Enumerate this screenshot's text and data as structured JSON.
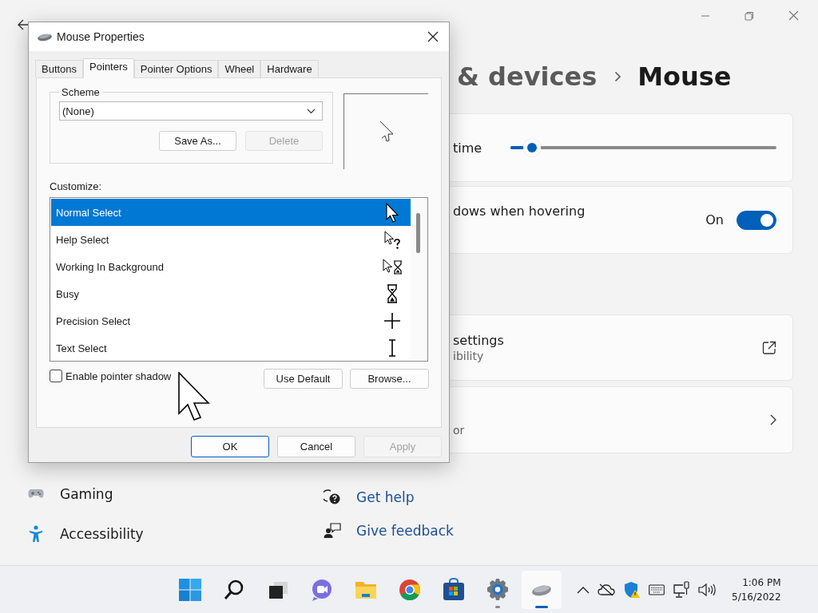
{
  "settings": {
    "breadcrumb_parent": "& devices",
    "page_title": "Mouse",
    "cards": [
      {
        "kind": "slider",
        "label": "time",
        "level": 0.08
      },
      {
        "kind": "toggle",
        "label": "dows when hovering",
        "state_text": "On",
        "on": true
      },
      {
        "kind": "link",
        "label": "settings",
        "sublabel": "ibility"
      },
      {
        "kind": "nav",
        "sublabel": "or"
      }
    ],
    "sidebar": {
      "items": [
        {
          "label": "Gaming",
          "kind": "gaming"
        },
        {
          "label": "Accessibility",
          "kind": "accessibility"
        }
      ]
    },
    "help_links": [
      {
        "label": "Get help",
        "kind": "help"
      },
      {
        "label": "Give feedback",
        "kind": "feedback"
      }
    ]
  },
  "dialog": {
    "title": "Mouse Properties",
    "tabs": [
      {
        "label": "Buttons",
        "selected": false
      },
      {
        "label": "Pointers",
        "selected": true
      },
      {
        "label": "Pointer Options",
        "selected": false
      },
      {
        "label": "Wheel",
        "selected": false
      },
      {
        "label": "Hardware",
        "selected": false
      }
    ],
    "scheme": {
      "label": "Scheme",
      "value": "(None)"
    },
    "scheme_buttons": [
      {
        "label": "Save As...",
        "disabled": false
      },
      {
        "label": "Delete",
        "disabled": true
      }
    ],
    "customize_label": "Customize:",
    "pointers": [
      {
        "name": "Normal Select",
        "kind": "arrow",
        "selected": true
      },
      {
        "name": "Help Select",
        "kind": "help",
        "selected": false
      },
      {
        "name": "Working In Background",
        "kind": "working",
        "selected": false
      },
      {
        "name": "Busy",
        "kind": "busy",
        "selected": false
      },
      {
        "name": "Precision Select",
        "kind": "cross",
        "selected": false
      },
      {
        "name": "Text Select",
        "kind": "text",
        "selected": false
      }
    ],
    "pointer_shadow": {
      "label": "Enable pointer shadow",
      "checked": false
    },
    "list_buttons": [
      {
        "label": "Use Default",
        "disabled": false
      },
      {
        "label": "Browse...",
        "disabled": false
      }
    ],
    "buttons": [
      {
        "label": "OK",
        "default": true,
        "disabled": false
      },
      {
        "label": "Cancel",
        "default": false,
        "disabled": false
      },
      {
        "label": "Apply",
        "default": false,
        "disabled": true
      }
    ]
  },
  "taskbar": {
    "apps": [
      {
        "kind": "start",
        "running": false,
        "active": false
      },
      {
        "kind": "search",
        "running": false,
        "active": false
      },
      {
        "kind": "taskview",
        "running": false,
        "active": false
      },
      {
        "kind": "chat",
        "running": false,
        "active": false
      },
      {
        "kind": "explorer",
        "running": false,
        "active": false
      },
      {
        "kind": "chrome",
        "running": false,
        "active": false
      },
      {
        "kind": "store",
        "running": false,
        "active": false
      },
      {
        "kind": "settings",
        "running": true,
        "active": false
      },
      {
        "kind": "mouse",
        "running": true,
        "active": true
      }
    ],
    "clock": {
      "time": "1:06 PM",
      "date": "5/16/2022"
    }
  }
}
